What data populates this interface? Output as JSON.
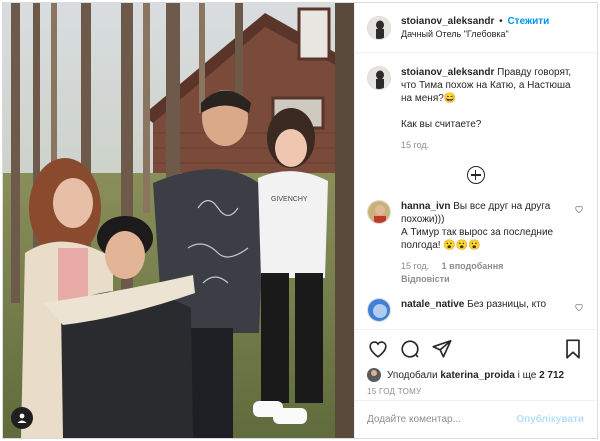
{
  "header": {
    "username": "stoianov_aleksandr",
    "separator": "•",
    "follow_label": "Стежити",
    "location": "Дачный Отель \"Глебовка\""
  },
  "caption": {
    "username": "stoianov_aleksandr",
    "text": "Правду говорят, что Тима похож на Катю, а Настюша на меня?😄",
    "text2": "Как вы считаете?",
    "time": "15 год."
  },
  "load_more_icon": "plus-circle-icon",
  "comments": [
    {
      "username": "hanna_ivn",
      "text": "Вы все друг на друга похожи)))",
      "text2": "А Тимур так вырос за последние полгода! 😮😮😮",
      "time": "15 год.",
      "likes": "1 вподобання",
      "reply": "Відповісти"
    },
    {
      "username": "natale_native",
      "text": "Без разницы, кто"
    }
  ],
  "likes": {
    "prefix": "Уподобали",
    "user": "katerina_proida",
    "middle": "і ще",
    "count": "2 712"
  },
  "time_ago": "15 ГОД ТОМУ",
  "add_comment": {
    "placeholder": "Додайте коментар...",
    "publish_label": "Опублікувати"
  },
  "colors": {
    "accent": "#0095f6",
    "publish_disabled": "#b2dffc",
    "muted": "#8e8e8e",
    "border": "#dbdbdb"
  },
  "icons": [
    "heart-icon",
    "comment-icon",
    "share-icon",
    "bookmark-icon",
    "user-tag-icon"
  ]
}
